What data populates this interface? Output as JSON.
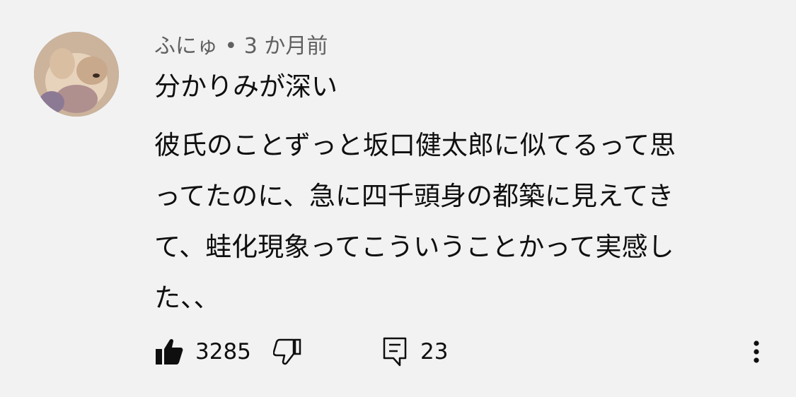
{
  "comment": {
    "author": "ふにゅ",
    "separator": "•",
    "time_ago": "3 か月前",
    "title": "分かりみが深い",
    "body": "彼氏のことずっと坂口健太郎に似てるって思\nってたのに、急に四千頭身の都築に見えてき\nて、蛙化現象ってこういうことかって実感し\nた、、",
    "like_count": "3285",
    "reply_count": "23"
  },
  "icons": {
    "like": "thumbs-up-filled-icon",
    "dislike": "thumbs-down-outline-icon",
    "reply": "comment-icon",
    "more": "vertical-ellipsis-icon",
    "avatar": "puppy-avatar"
  },
  "colors": {
    "background": "#f2f2f2",
    "text": "#0f0f0f",
    "meta": "#606060"
  }
}
